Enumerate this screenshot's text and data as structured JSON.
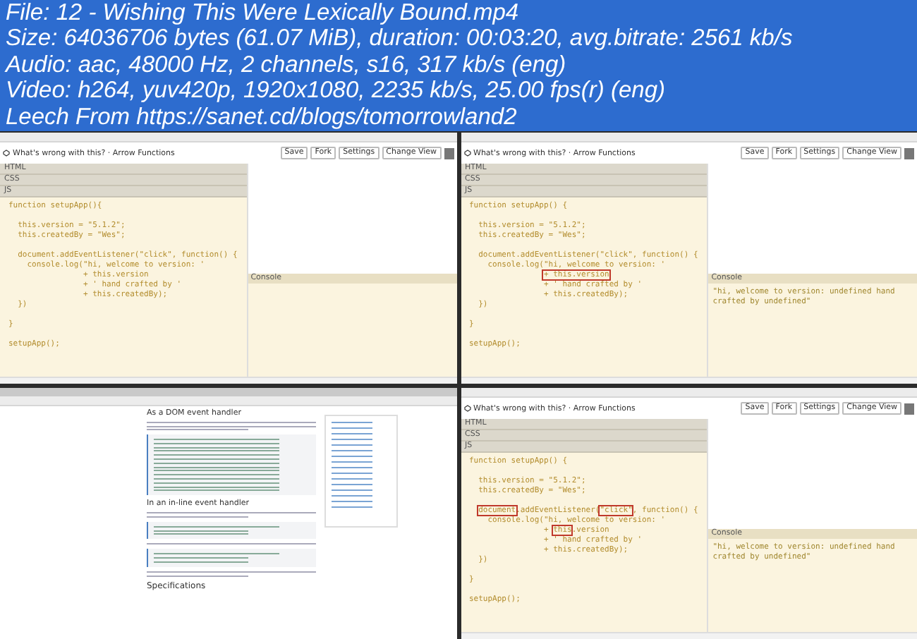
{
  "header": {
    "lines": [
      "File: 12 - Wishing This Were Lexically Bound.mp4",
      "Size: 64036706 bytes (61.07 MiB), duration: 00:03:20, avg.bitrate: 2561 kb/s",
      "Audio: aac, 48000 Hz, 2 channels, s16, 317 kb/s (eng)",
      "Video: h264, yuv420p, 1920x1080, 2235 kb/s, 25.00 fps(r) (eng)",
      "Leech From https://sanet.cd/blogs/tomorrowland2"
    ]
  },
  "frames": [
    {
      "kind": "codepen",
      "title": "What's wrong with this? · Arrow Functions",
      "buttons": [
        "Save",
        "Fork",
        "Settings",
        "Change View"
      ],
      "panels": [
        "HTML",
        "CSS",
        "JS"
      ],
      "console_label": "Console",
      "code": [
        {
          "space_before": false,
          "segments": [
            {
              "text": "function setupApp(){",
              "highlighted": false
            }
          ]
        },
        {
          "space_before": true,
          "segments": [
            {
              "text": "  this.version = \"5.1.2\";",
              "highlighted": false
            }
          ]
        },
        {
          "space_before": false,
          "segments": [
            {
              "text": "  this.createdBy = \"Wes\";",
              "highlighted": false
            }
          ]
        },
        {
          "space_before": true,
          "segments": [
            {
              "text": "  document.addEventListener(\"click\", function() {",
              "highlighted": false
            }
          ]
        },
        {
          "space_before": false,
          "segments": [
            {
              "text": "    console.log(\"hi, welcome to version: '",
              "highlighted": false
            }
          ]
        },
        {
          "space_before": false,
          "segments": [
            {
              "text": "                + this.version",
              "highlighted": false
            }
          ]
        },
        {
          "space_before": false,
          "segments": [
            {
              "text": "                + ' hand crafted by '",
              "highlighted": false
            }
          ]
        },
        {
          "space_before": false,
          "segments": [
            {
              "text": "                + this.createdBy);",
              "highlighted": false
            }
          ]
        },
        {
          "space_before": false,
          "segments": [
            {
              "text": "  })",
              "highlighted": false
            }
          ]
        },
        {
          "space_before": true,
          "segments": [
            {
              "text": "}",
              "highlighted": false
            }
          ]
        },
        {
          "space_before": true,
          "segments": [
            {
              "text": "setupApp();",
              "highlighted": false
            }
          ]
        }
      ]
    },
    {
      "kind": "codepen",
      "title": "What's wrong with this? · Arrow Functions",
      "buttons": [
        "Save",
        "Fork",
        "Settings",
        "Change View"
      ],
      "panels": [
        "HTML",
        "CSS",
        "JS"
      ],
      "console_label": "Console",
      "console_output": "\"hi, welcome to version: undefined hand crafted by undefined\"",
      "code": [
        {
          "space_before": false,
          "segments": [
            {
              "text": "function setupApp() {",
              "highlighted": false
            }
          ]
        },
        {
          "space_before": true,
          "segments": [
            {
              "text": "  this.version = \"5.1.2\";",
              "highlighted": false
            }
          ]
        },
        {
          "space_before": false,
          "segments": [
            {
              "text": "  this.createdBy = \"Wes\";",
              "highlighted": false
            }
          ]
        },
        {
          "space_before": true,
          "segments": [
            {
              "text": "  document.addEventListener(\"click\", function() {",
              "highlighted": false
            }
          ]
        },
        {
          "space_before": false,
          "segments": [
            {
              "text": "    console.log(\"hi, welcome to version: '",
              "highlighted": false
            }
          ]
        },
        {
          "space_before": false,
          "segments": [
            {
              "text": "                + this.version",
              "highlighted": true
            }
          ]
        },
        {
          "space_before": false,
          "segments": [
            {
              "text": "                + ' hand crafted by '",
              "highlighted": false
            }
          ]
        },
        {
          "space_before": false,
          "segments": [
            {
              "text": "                + this.createdBy);",
              "highlighted": false
            }
          ]
        },
        {
          "space_before": false,
          "segments": [
            {
              "text": "  })",
              "highlighted": false
            }
          ]
        },
        {
          "space_before": true,
          "segments": [
            {
              "text": "}",
              "highlighted": false
            }
          ]
        },
        {
          "space_before": true,
          "segments": [
            {
              "text": "setupApp();",
              "highlighted": false
            }
          ]
        }
      ]
    },
    {
      "kind": "docs",
      "headings": [
        "As a DOM event handler",
        "In an in-line event handler",
        "Specifications"
      ]
    },
    {
      "kind": "codepen",
      "title": "What's wrong with this? · Arrow Functions",
      "buttons": [
        "Save",
        "Fork",
        "Settings",
        "Change View"
      ],
      "panels": [
        "HTML",
        "CSS",
        "JS"
      ],
      "console_label": "Console",
      "console_output": "\"hi, welcome to version: undefined hand crafted by undefined\"",
      "code": [
        {
          "space_before": false,
          "segments": [
            {
              "text": "function setupApp() {",
              "highlighted": false
            }
          ]
        },
        {
          "space_before": true,
          "segments": [
            {
              "text": "  this.version = \"5.1.2\";",
              "highlighted": false
            }
          ]
        },
        {
          "space_before": false,
          "segments": [
            {
              "text": "  this.createdBy = \"Wes\";",
              "highlighted": false
            }
          ]
        },
        {
          "space_before": true,
          "segments": [
            {
              "text": "  document",
              "highlighted": true
            },
            {
              "text": ".addEventListener(",
              "highlighted": false
            },
            {
              "text": "\"click\"",
              "highlighted": true
            },
            {
              "text": ", function() {",
              "highlighted": false
            }
          ]
        },
        {
          "space_before": false,
          "segments": [
            {
              "text": "    console.log(\"hi, welcome to version: '",
              "highlighted": false
            }
          ]
        },
        {
          "space_before": false,
          "segments": [
            {
              "text": "                + ",
              "highlighted": false
            },
            {
              "text": "this",
              "highlighted": true
            },
            {
              "text": ".version",
              "highlighted": false
            }
          ]
        },
        {
          "space_before": false,
          "segments": [
            {
              "text": "                + ' hand crafted by '",
              "highlighted": false
            }
          ]
        },
        {
          "space_before": false,
          "segments": [
            {
              "text": "                + this.createdBy);",
              "highlighted": false
            }
          ]
        },
        {
          "space_before": false,
          "segments": [
            {
              "text": "  })",
              "highlighted": false
            }
          ]
        },
        {
          "space_before": true,
          "segments": [
            {
              "text": "}",
              "highlighted": false
            }
          ]
        },
        {
          "space_before": true,
          "segments": [
            {
              "text": "setupApp();",
              "highlighted": false
            }
          ]
        }
      ]
    }
  ]
}
